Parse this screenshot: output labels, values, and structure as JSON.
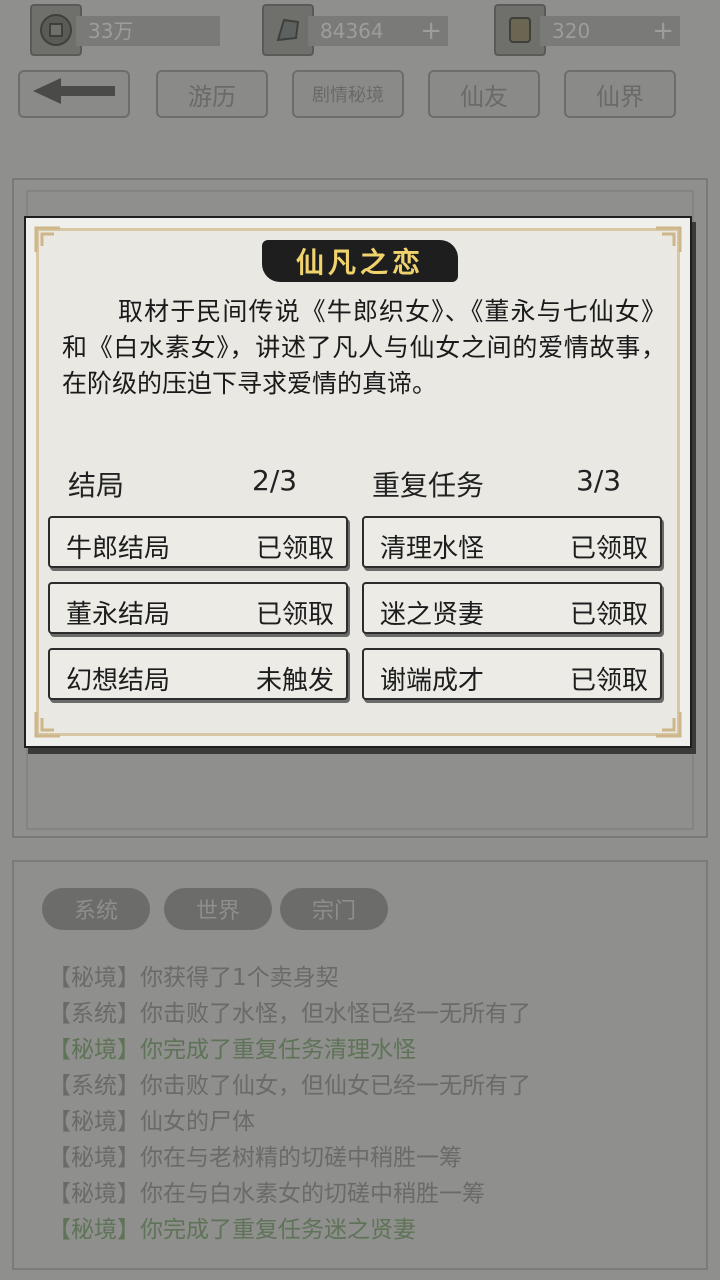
{
  "resources": [
    {
      "icon": "gold-coin-icon",
      "value": "33万"
    },
    {
      "icon": "jade-stone-icon",
      "value": "84364",
      "plus": "+"
    },
    {
      "icon": "scroll-icon",
      "value": "320",
      "plus": "+"
    }
  ],
  "nav": {
    "back_icon": "back-arrow-icon",
    "tabs": [
      "游历",
      "剧情秘境",
      "仙友",
      "仙界"
    ]
  },
  "modal": {
    "title": "仙凡之恋",
    "description": "取材于民间传说《牛郎织女》、《董永与七仙女》和《白水素女》，讲述了凡人与仙女之间的爱情故事，在阶级的压迫下寻求爱情的真谛。",
    "endings": {
      "label": "结局",
      "progress": "2/3",
      "items": [
        {
          "name": "牛郎结局",
          "status": "已领取"
        },
        {
          "name": "董永结局",
          "status": "已领取"
        },
        {
          "name": "幻想结局",
          "status": "未触发"
        }
      ]
    },
    "repeat_tasks": {
      "label": "重复任务",
      "progress": "3/3",
      "items": [
        {
          "name": "清理水怪",
          "status": "已领取"
        },
        {
          "name": "迷之贤妻",
          "status": "已领取"
        },
        {
          "name": "谢端成才",
          "status": "已领取"
        }
      ]
    }
  },
  "log": {
    "tabs": [
      "系统",
      "世界",
      "宗门"
    ],
    "lines": [
      {
        "text": "【秘境】你获得了1个卖身契",
        "green": false
      },
      {
        "text": "【系统】你击败了水怪，但水怪已经一无所有了",
        "green": false
      },
      {
        "text": "【秘境】你完成了重复任务清理水怪",
        "green": true
      },
      {
        "text": "【系统】你击败了仙女，但仙女已经一无所有了",
        "green": false
      },
      {
        "text": "【秘境】仙女的尸体",
        "green": false
      },
      {
        "text": "【秘境】你在与老树精的切磋中稍胜一筹",
        "green": false
      },
      {
        "text": "【秘境】你在与白水素女的切磋中稍胜一筹",
        "green": false
      },
      {
        "text": "【秘境】你完成了重复任务迷之贤妻",
        "green": true
      }
    ]
  },
  "colors": {
    "title_gold": "#f1d36e",
    "log_green": "#5f7358"
  }
}
